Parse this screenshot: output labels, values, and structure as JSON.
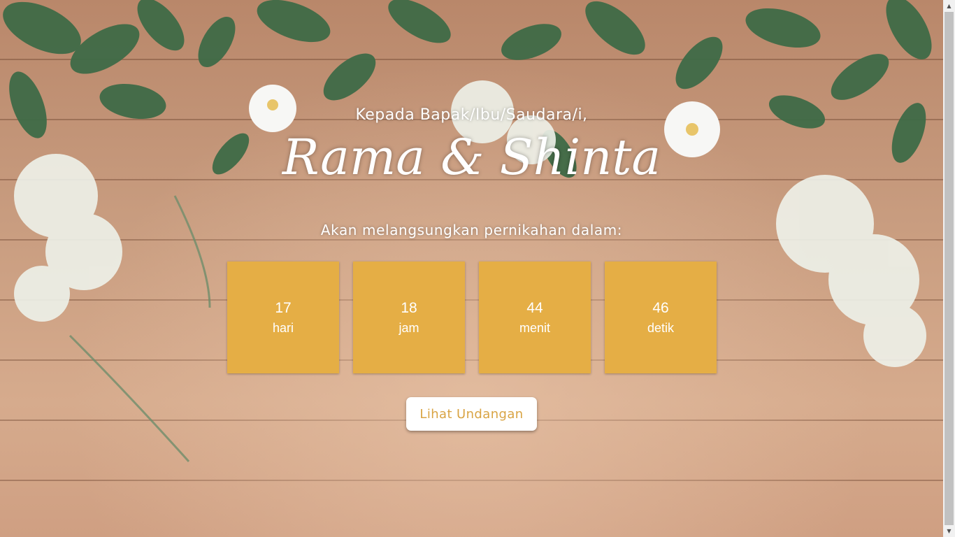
{
  "hero": {
    "greeting": "Kepada Bapak/Ibu/Saudara/i,",
    "couple_names": "Rama & Shinta",
    "announcement": "Akan melangsungkan pernikahan dalam:"
  },
  "countdown": [
    {
      "value": "17",
      "unit": "hari"
    },
    {
      "value": "18",
      "unit": "jam"
    },
    {
      "value": "44",
      "unit": "menit"
    },
    {
      "value": "46",
      "unit": "detik"
    }
  ],
  "cta": {
    "label": "Lihat Undangan"
  },
  "colors": {
    "accent": "#e5ae45",
    "button_text": "#d9a444",
    "wood": "#c89c7f",
    "leaf": "#3d6a44"
  }
}
